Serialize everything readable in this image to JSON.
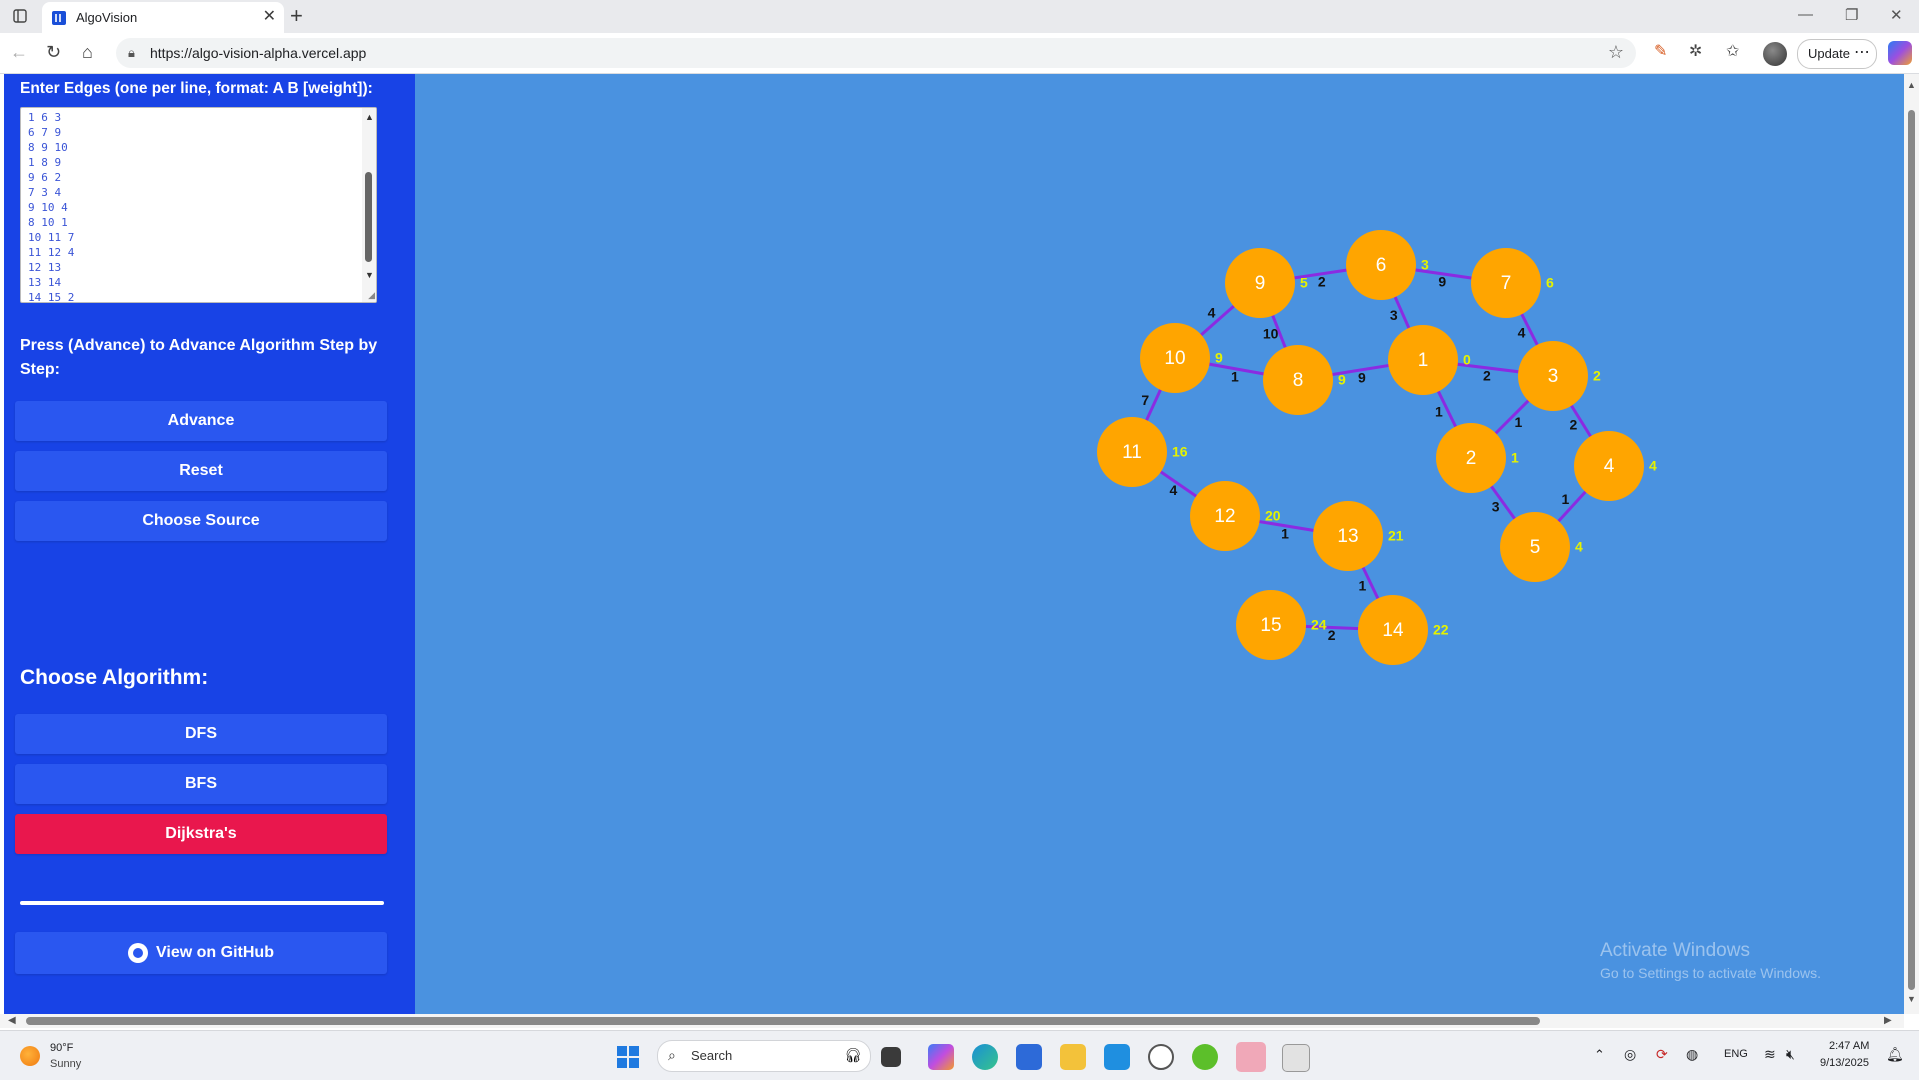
{
  "browser": {
    "tab_title": "AlgoVision",
    "url": "https://algo-vision-alpha.vercel.app",
    "update_label": "Update"
  },
  "sidebar": {
    "edges_label": "Enter Edges (one per line, format: A B [weight]):",
    "edges_text": "1 6 3\n6 7 9\n8 9 10\n1 8 9\n9 6 2\n7 3 4\n9 10 4\n8 10 1\n10 11 7\n11 12 4\n12 13\n13 14\n14 15 2",
    "instructions": "Press (Advance) to Advance Algorithm Step by Step:",
    "advance_label": "Advance",
    "reset_label": "Reset",
    "choose_source_label": "Choose Source",
    "algorithm_heading": "Choose Algorithm:",
    "algorithms": [
      "DFS",
      "BFS",
      "Dijkstra's"
    ],
    "active_algorithm": "Dijkstra's",
    "github_label": "View on GitHub"
  },
  "graph": {
    "node_color": "#ffa500",
    "edge_color": "#8a2be2",
    "distance_color": "#e5f200",
    "nodes": [
      {
        "id": "1",
        "dist": "0"
      },
      {
        "id": "2",
        "dist": "1"
      },
      {
        "id": "3",
        "dist": "2"
      },
      {
        "id": "4",
        "dist": "4"
      },
      {
        "id": "5",
        "dist": "4"
      },
      {
        "id": "6",
        "dist": "3"
      },
      {
        "id": "7",
        "dist": "6"
      },
      {
        "id": "8",
        "dist": "9"
      },
      {
        "id": "9",
        "dist": "5"
      },
      {
        "id": "10",
        "dist": "9"
      },
      {
        "id": "11",
        "dist": "16"
      },
      {
        "id": "12",
        "dist": "20"
      },
      {
        "id": "13",
        "dist": "21"
      },
      {
        "id": "14",
        "dist": "22"
      },
      {
        "id": "15",
        "dist": "24"
      }
    ],
    "edges": [
      {
        "from": "9",
        "to": "6",
        "weight": "2"
      },
      {
        "from": "6",
        "to": "7",
        "weight": "9"
      },
      {
        "from": "6",
        "to": "1",
        "weight": "3"
      },
      {
        "from": "9",
        "to": "10",
        "weight": "4"
      },
      {
        "from": "9",
        "to": "8",
        "weight": "10"
      },
      {
        "from": "7",
        "to": "3",
        "weight": "4"
      },
      {
        "from": "10",
        "to": "8",
        "weight": "1"
      },
      {
        "from": "8",
        "to": "1",
        "weight": "9"
      },
      {
        "from": "1",
        "to": "3",
        "weight": "2"
      },
      {
        "from": "10",
        "to": "11",
        "weight": "7"
      },
      {
        "from": "1",
        "to": "2",
        "weight": "1"
      },
      {
        "from": "2",
        "to": "3",
        "weight": "1"
      },
      {
        "from": "3",
        "to": "4",
        "weight": "2"
      },
      {
        "from": "11",
        "to": "12",
        "weight": "4"
      },
      {
        "from": "12",
        "to": "13",
        "weight": "1"
      },
      {
        "from": "2",
        "to": "5",
        "weight": "3"
      },
      {
        "from": "4",
        "to": "5",
        "weight": "1"
      },
      {
        "from": "13",
        "to": "14",
        "weight": "1"
      },
      {
        "from": "15",
        "to": "14",
        "weight": "2"
      }
    ]
  },
  "watermark": {
    "title": "Activate Windows",
    "subtitle": "Go to Settings to activate Windows."
  },
  "taskbar": {
    "temperature": "90°F",
    "weather": "Sunny",
    "search_placeholder": "Search",
    "language": "ENG",
    "time": "2:47 AM",
    "date": "9/13/2025"
  }
}
